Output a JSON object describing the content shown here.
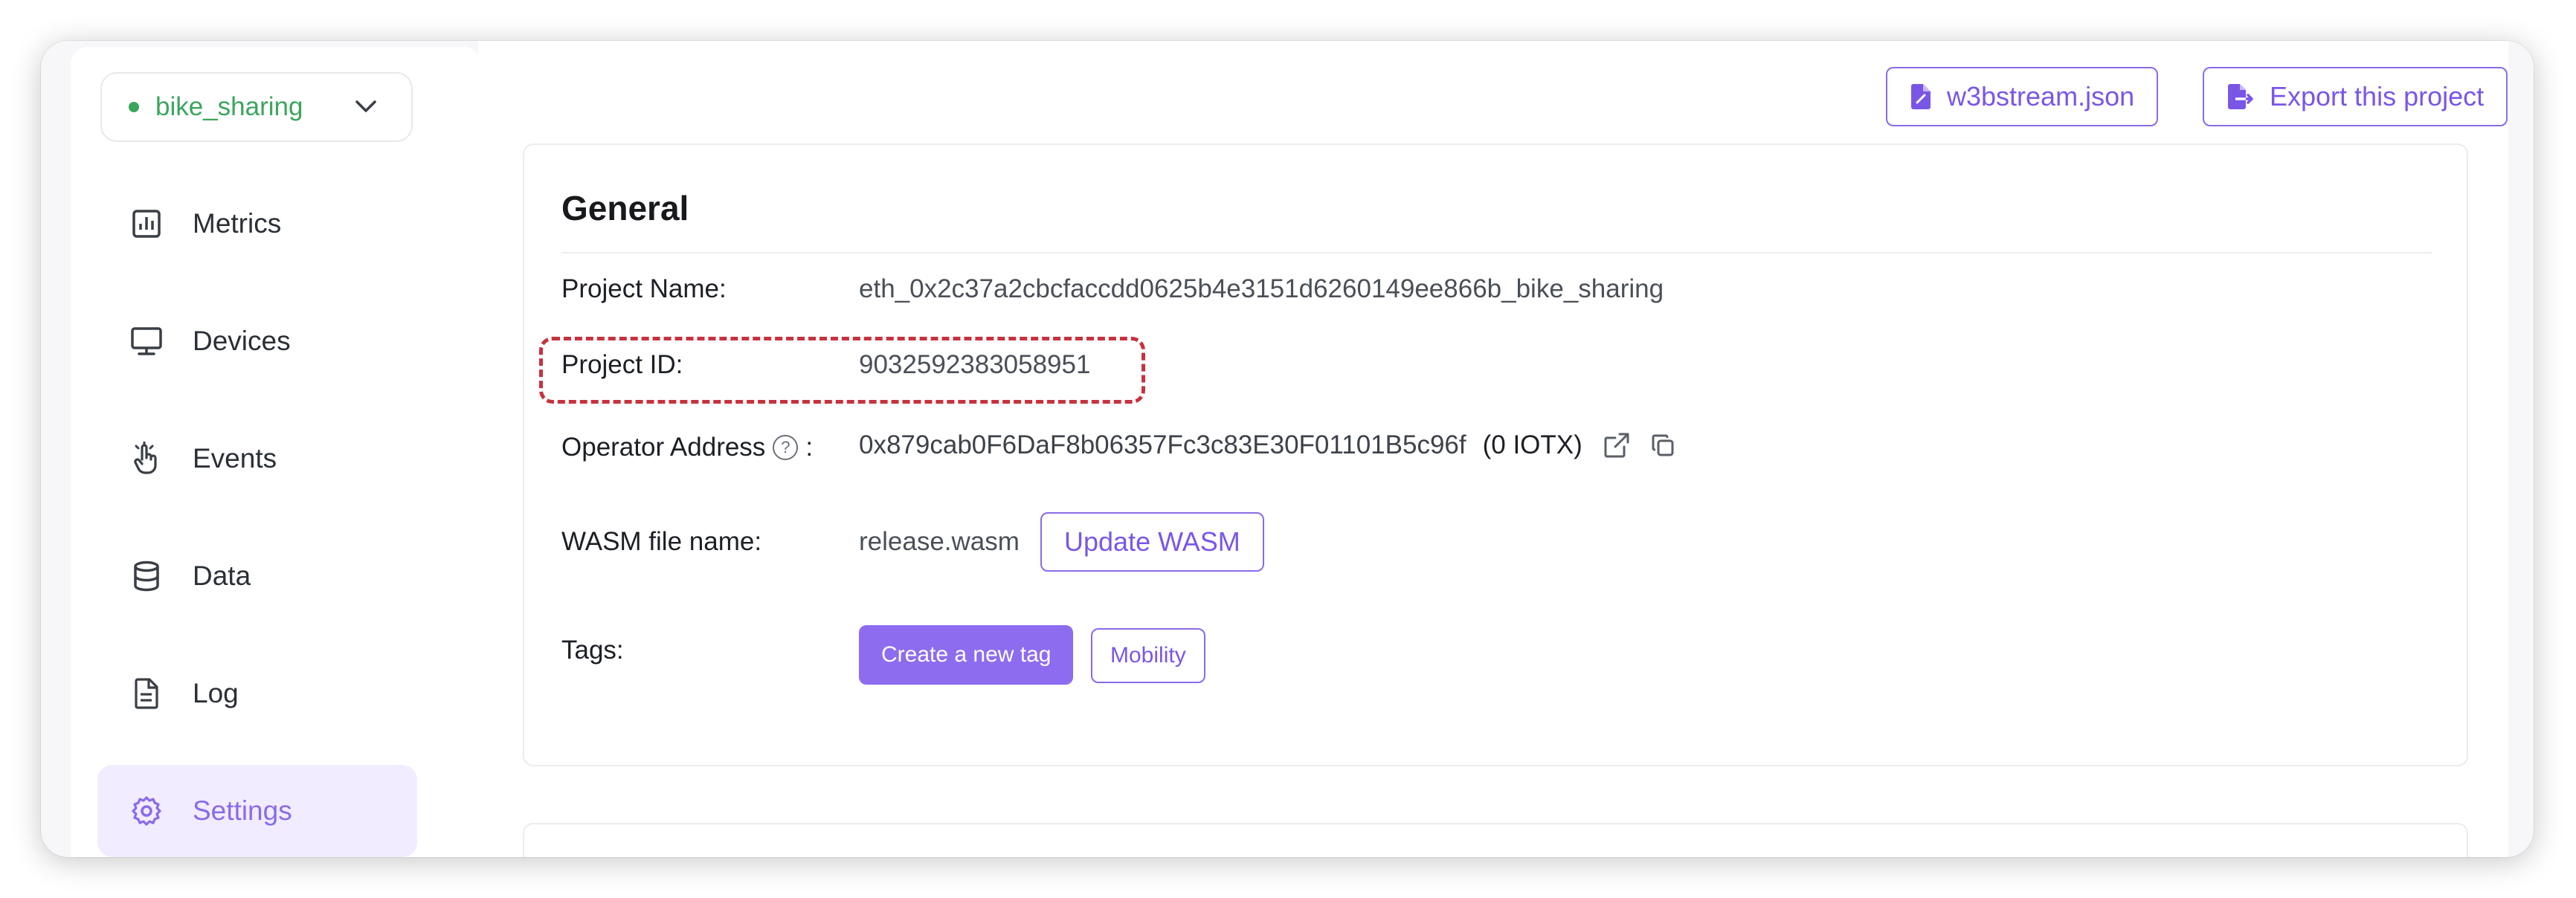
{
  "sidebar": {
    "project": {
      "name": "bike_sharing",
      "status_color": "#3ba55d"
    },
    "items": [
      {
        "label": "Metrics",
        "icon": "bar-chart-icon"
      },
      {
        "label": "Devices",
        "icon": "monitor-icon"
      },
      {
        "label": "Events",
        "icon": "pointer-hand-icon"
      },
      {
        "label": "Data",
        "icon": "database-icon"
      },
      {
        "label": "Log",
        "icon": "file-text-icon"
      },
      {
        "label": "Settings",
        "icon": "gear-icon",
        "active": true
      }
    ]
  },
  "header": {
    "json_button": "w3bstream.json",
    "export_button": "Export this project"
  },
  "general": {
    "title": "General",
    "project_name_label": "Project Name:",
    "project_name_value": "eth_0x2c37a2cbcfaccdd0625b4e3151d6260149ee866b_bike_sharing",
    "project_id_label": "Project ID:",
    "project_id_value": "9032592383058951",
    "operator_label": "Operator Address",
    "operator_colon": ":",
    "operator_address": "0x879cab0F6DaF8b06357Fc3c83E30F01101B5c96f",
    "operator_balance": "(0 IOTX)",
    "wasm_label": "WASM file name:",
    "wasm_value": "release.wasm",
    "update_wasm_button": "Update WASM",
    "tags_label": "Tags:",
    "create_tag_button": "Create a new tag",
    "tags": [
      "Mobility"
    ]
  },
  "colors": {
    "accent": "#8a6be8",
    "accent_fill": "#8d6cf0",
    "highlight_border": "#c6323d"
  }
}
